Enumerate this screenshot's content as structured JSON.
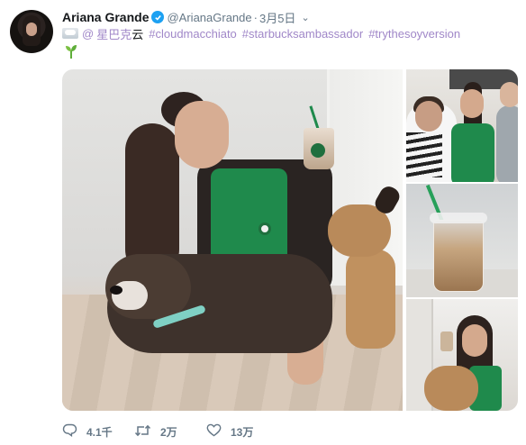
{
  "tweet": {
    "author_name": "Ariana Grande",
    "author_handle": "@ArianaGrande",
    "separator": "·",
    "date": "3月5日",
    "menu_caret": "⌄",
    "mention": "星巴克云",
    "mention_prefix": "@",
    "mention_link_part": "星巴克",
    "mention_plain_part": "云",
    "hashtags": [
      "#cloudmacchiato",
      "#starbucksambassador",
      "#trythesoyversion"
    ],
    "emoji_icons": [
      "cloud-emoji-icon",
      "seedling-emoji-icon"
    ]
  },
  "media": {
    "photos": [
      "photo-main",
      "photo-group",
      "photo-drink",
      "photo-dog-kiss"
    ]
  },
  "actions": {
    "reply_count": "4.1千",
    "retweet_count": "2万",
    "like_count": "13万"
  },
  "colors": {
    "link": "#a087c8",
    "verified": "#1da1f2",
    "meta_text": "#657786",
    "starbucks_green": "#1f8a4c"
  }
}
